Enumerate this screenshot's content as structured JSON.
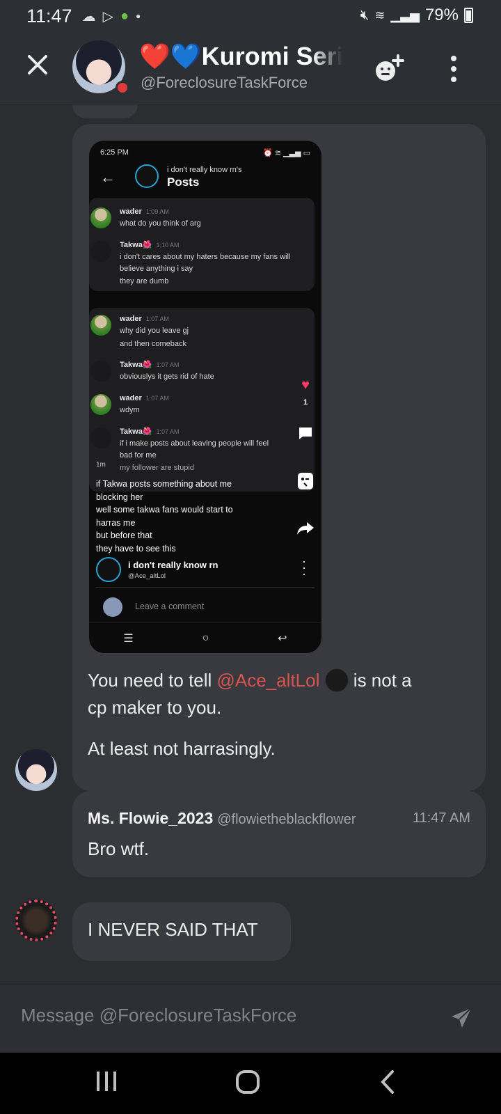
{
  "status": {
    "time": "11:47",
    "battery": "79%"
  },
  "header": {
    "hearts": "❤️💙",
    "name": "Kuromi Seri",
    "handle": "@ForeclosureTaskForce"
  },
  "screenshot": {
    "time": "6:25 PM",
    "subtitle": "i don't really know rn's",
    "title": "Posts",
    "card1": [
      {
        "who": "wader",
        "time": "1:09 AM",
        "text": "what do you think of arg"
      },
      {
        "who": "Takwa🌺",
        "time": "1:10 AM",
        "text": "i don't cares about my haters because my fans will believe anything i say"
      },
      {
        "text": "they are dumb"
      }
    ],
    "card2": [
      {
        "who": "wader",
        "time": "1:07 AM",
        "text": "why did you leave gj"
      },
      {
        "text": "and then comeback"
      },
      {
        "who": "Takwa🌺",
        "time": "1:07 AM",
        "text": "obviouslys it gets rid of hate"
      },
      {
        "who": "wader",
        "time": "1:07 AM",
        "text": "wdym"
      },
      {
        "who": "Takwa🌺",
        "time": "1:07 AM",
        "text": "if i make posts about leaving people will feel bad for me"
      },
      {
        "text": "my follower are stupid"
      }
    ],
    "likes": "1",
    "time_ago": "1m",
    "caption": [
      "if Takwa posts something about me",
      "blocking her",
      "well some takwa fans would start to",
      "harras me",
      "but before that",
      "they have to see this"
    ],
    "author_name": "i don't really know rn",
    "author_handle": "@Ace_altLol",
    "comment_placeholder": "Leave a comment"
  },
  "message1": {
    "part1": "You need to tell ",
    "mention": "@Ace_altLol",
    "part2": " is not a",
    "line2": "cp maker to you.",
    "para2": "At least not harrasingly."
  },
  "reply": {
    "name": "Ms. Flowie_2023",
    "handle": "@flowietheblackflower",
    "time": "11:47 AM",
    "text": "Bro wtf."
  },
  "message2": {
    "text": "I NEVER SAID THAT"
  },
  "composer": {
    "placeholder": "Message @ForeclosureTaskForce"
  },
  "colors": {
    "background": "#2b2d31",
    "bubble": "#383a40",
    "mention": "#d9534f"
  }
}
